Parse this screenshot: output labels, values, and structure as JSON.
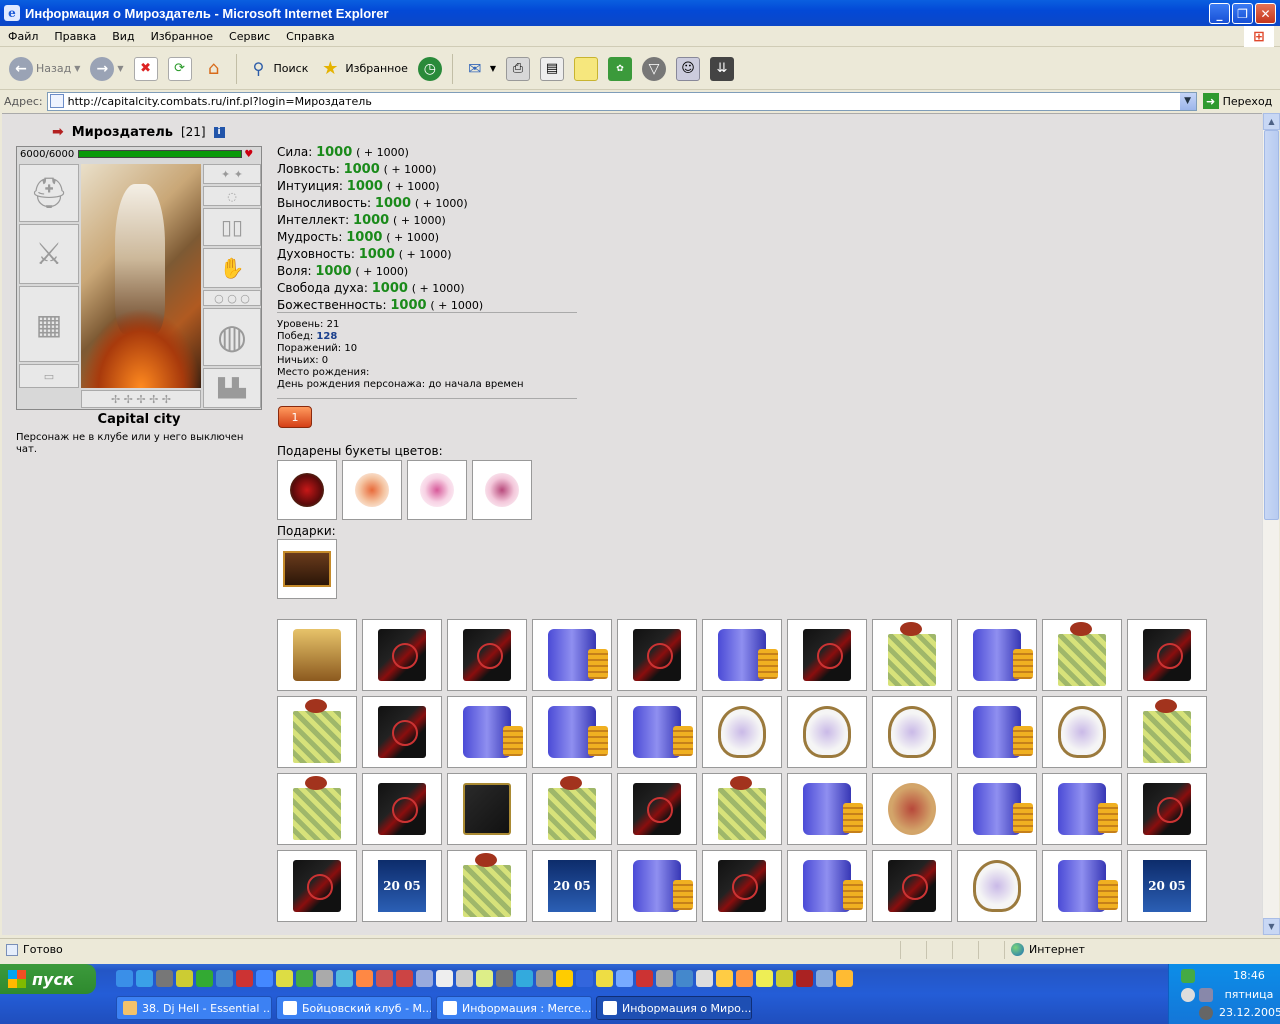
{
  "window": {
    "title": "Информация о Мироздатель - Microsoft Internet Explorer"
  },
  "menu": [
    "Файл",
    "Правка",
    "Вид",
    "Избранное",
    "Сервис",
    "Справка"
  ],
  "toolbar": {
    "back": "Назад",
    "search": "Поиск",
    "favorites": "Избранное"
  },
  "address": {
    "label": "Адрес:",
    "url": "http://capitalcity.combats.ru/inf.pl?login=Мироздатель",
    "go": "Переход"
  },
  "character": {
    "name": "Мироздатель",
    "level_tag": "[21]",
    "hp": "6000/6000",
    "hp_fraction": 1.0,
    "city": "Capital city",
    "chat_note": "Персонаж не в клубе или у него выключен чат."
  },
  "stats": [
    {
      "label": "Сила:",
      "value": "1000",
      "bonus": "( + 1000)"
    },
    {
      "label": "Ловкость:",
      "value": "1000",
      "bonus": "( + 1000)"
    },
    {
      "label": "Интуиция:",
      "value": "1000",
      "bonus": "( + 1000)"
    },
    {
      "label": "Выносливость:",
      "value": "1000",
      "bonus": "( + 1000)"
    },
    {
      "label": "Интеллект:",
      "value": "1000",
      "bonus": "( + 1000)"
    },
    {
      "label": "Мудрость:",
      "value": "1000",
      "bonus": "( + 1000)"
    },
    {
      "label": "Духовность:",
      "value": "1000",
      "bonus": "( + 1000)"
    },
    {
      "label": "Воля:",
      "value": "1000",
      "bonus": "( + 1000)"
    },
    {
      "label": "Свобода духа:",
      "value": "1000",
      "bonus": "( + 1000)"
    },
    {
      "label": "Божественность:",
      "value": "1000",
      "bonus": "( + 1000)"
    }
  ],
  "info": {
    "level": "Уровень: 21",
    "wins_label": "Побед: ",
    "wins": "128",
    "losses": "Поражений: 10",
    "draws": "Ничьих: 0",
    "birthplace": "Место рождения:",
    "birthday": "День рождения персонажа: до начала времен"
  },
  "badge": "1",
  "flowers_label": "Подарены букеты цветов:",
  "gifts_label": "Подарки:",
  "status": {
    "text": "Готово",
    "zone": "Интернет"
  },
  "taskbar": {
    "start": "пуск",
    "tasks": [
      "38. Dj Hell - Essential ...",
      "Бойцовский клуб - М...",
      "Информация : Merce...",
      "Информация о Миро..."
    ],
    "time": "18:46",
    "day": "пятница",
    "date": "23.12.2005"
  }
}
